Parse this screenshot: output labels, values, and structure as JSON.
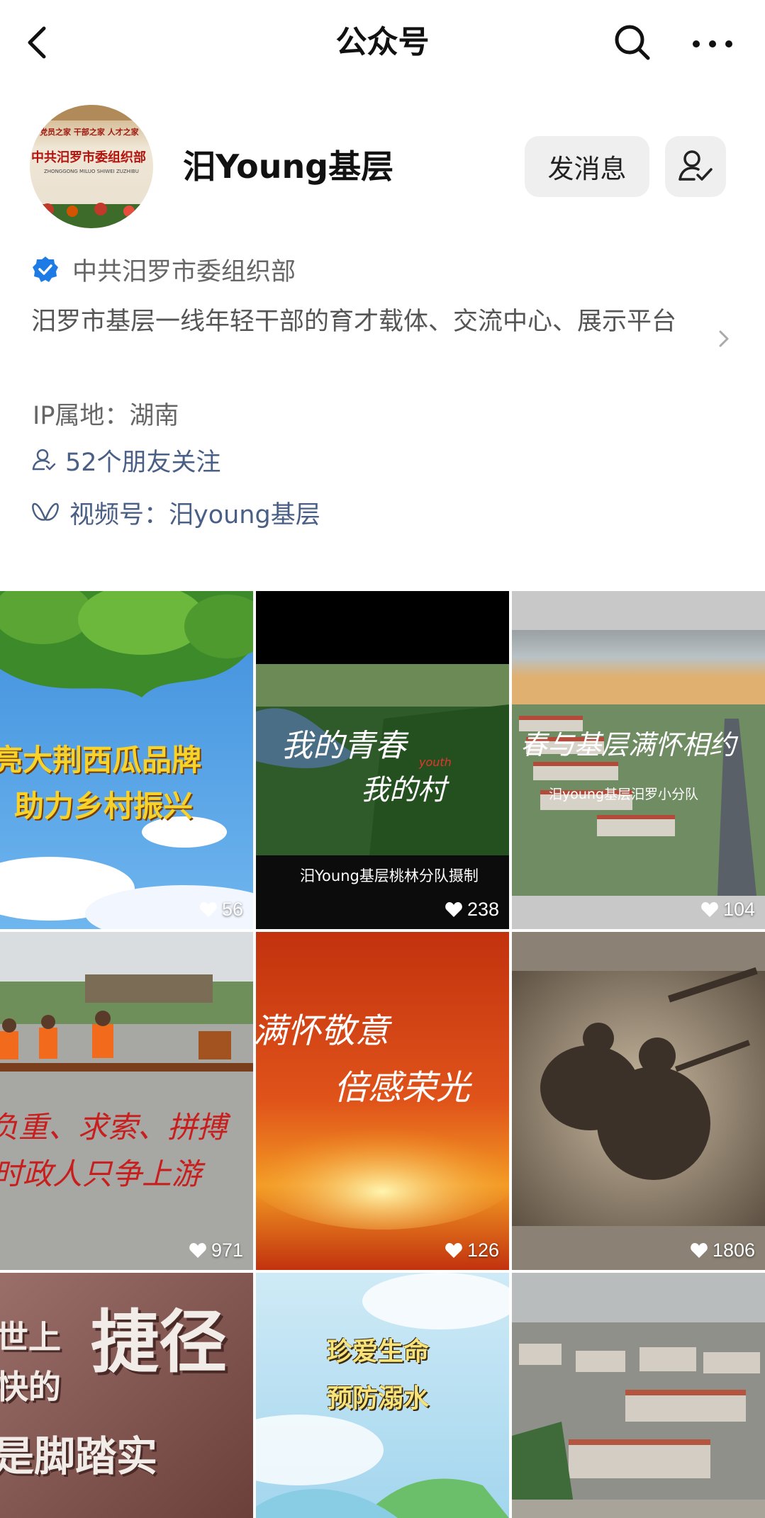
{
  "nav": {
    "title": "公众号"
  },
  "profile": {
    "avatar_lines": [
      "党员之家  干部之家  人才之家",
      "中共汨罗市委组织部",
      "ZHONGGONG MILUO SHIWEI ZUZHIBU"
    ],
    "name": "汨Young基层",
    "message_label": "发消息",
    "verified_org": "中共汨罗市委组织部",
    "description": "汨罗市基层一线年轻干部的育才载体、交流中心、展示平台",
    "ip_location": "IP属地：湖南",
    "friends_following": "52个朋友关注",
    "channels": "视频号：汨young基层"
  },
  "colors": {
    "link": "#4a5f86",
    "verified_badge": "#1e7be6",
    "button_bg": "#efefef"
  },
  "videos": [
    {
      "lines": [
        "亮大荆西瓜品牌",
        "助力乡村振兴"
      ],
      "likes": "56"
    },
    {
      "lines": [
        "我的青春",
        "youth",
        "我的村",
        "汨Young基层桃林分队摄制"
      ],
      "likes": "238"
    },
    {
      "lines": [
        "春与基层满怀相约",
        "汨young基层汨罗小分队"
      ],
      "likes": "104"
    },
    {
      "lines": [
        "负重、求索、拼搏",
        "时政人只争上游"
      ],
      "likes": "971"
    },
    {
      "lines": [
        "满怀敬意",
        "倍感荣光"
      ],
      "likes": "126"
    },
    {
      "lines": [],
      "likes": "1806"
    },
    {
      "lines": [
        "世上",
        "快的",
        "捷径",
        "是脚踏实"
      ],
      "likes": ""
    },
    {
      "lines": [
        "珍爱生命",
        "预防溺水"
      ],
      "likes": ""
    },
    {
      "lines": [],
      "likes": ""
    }
  ]
}
